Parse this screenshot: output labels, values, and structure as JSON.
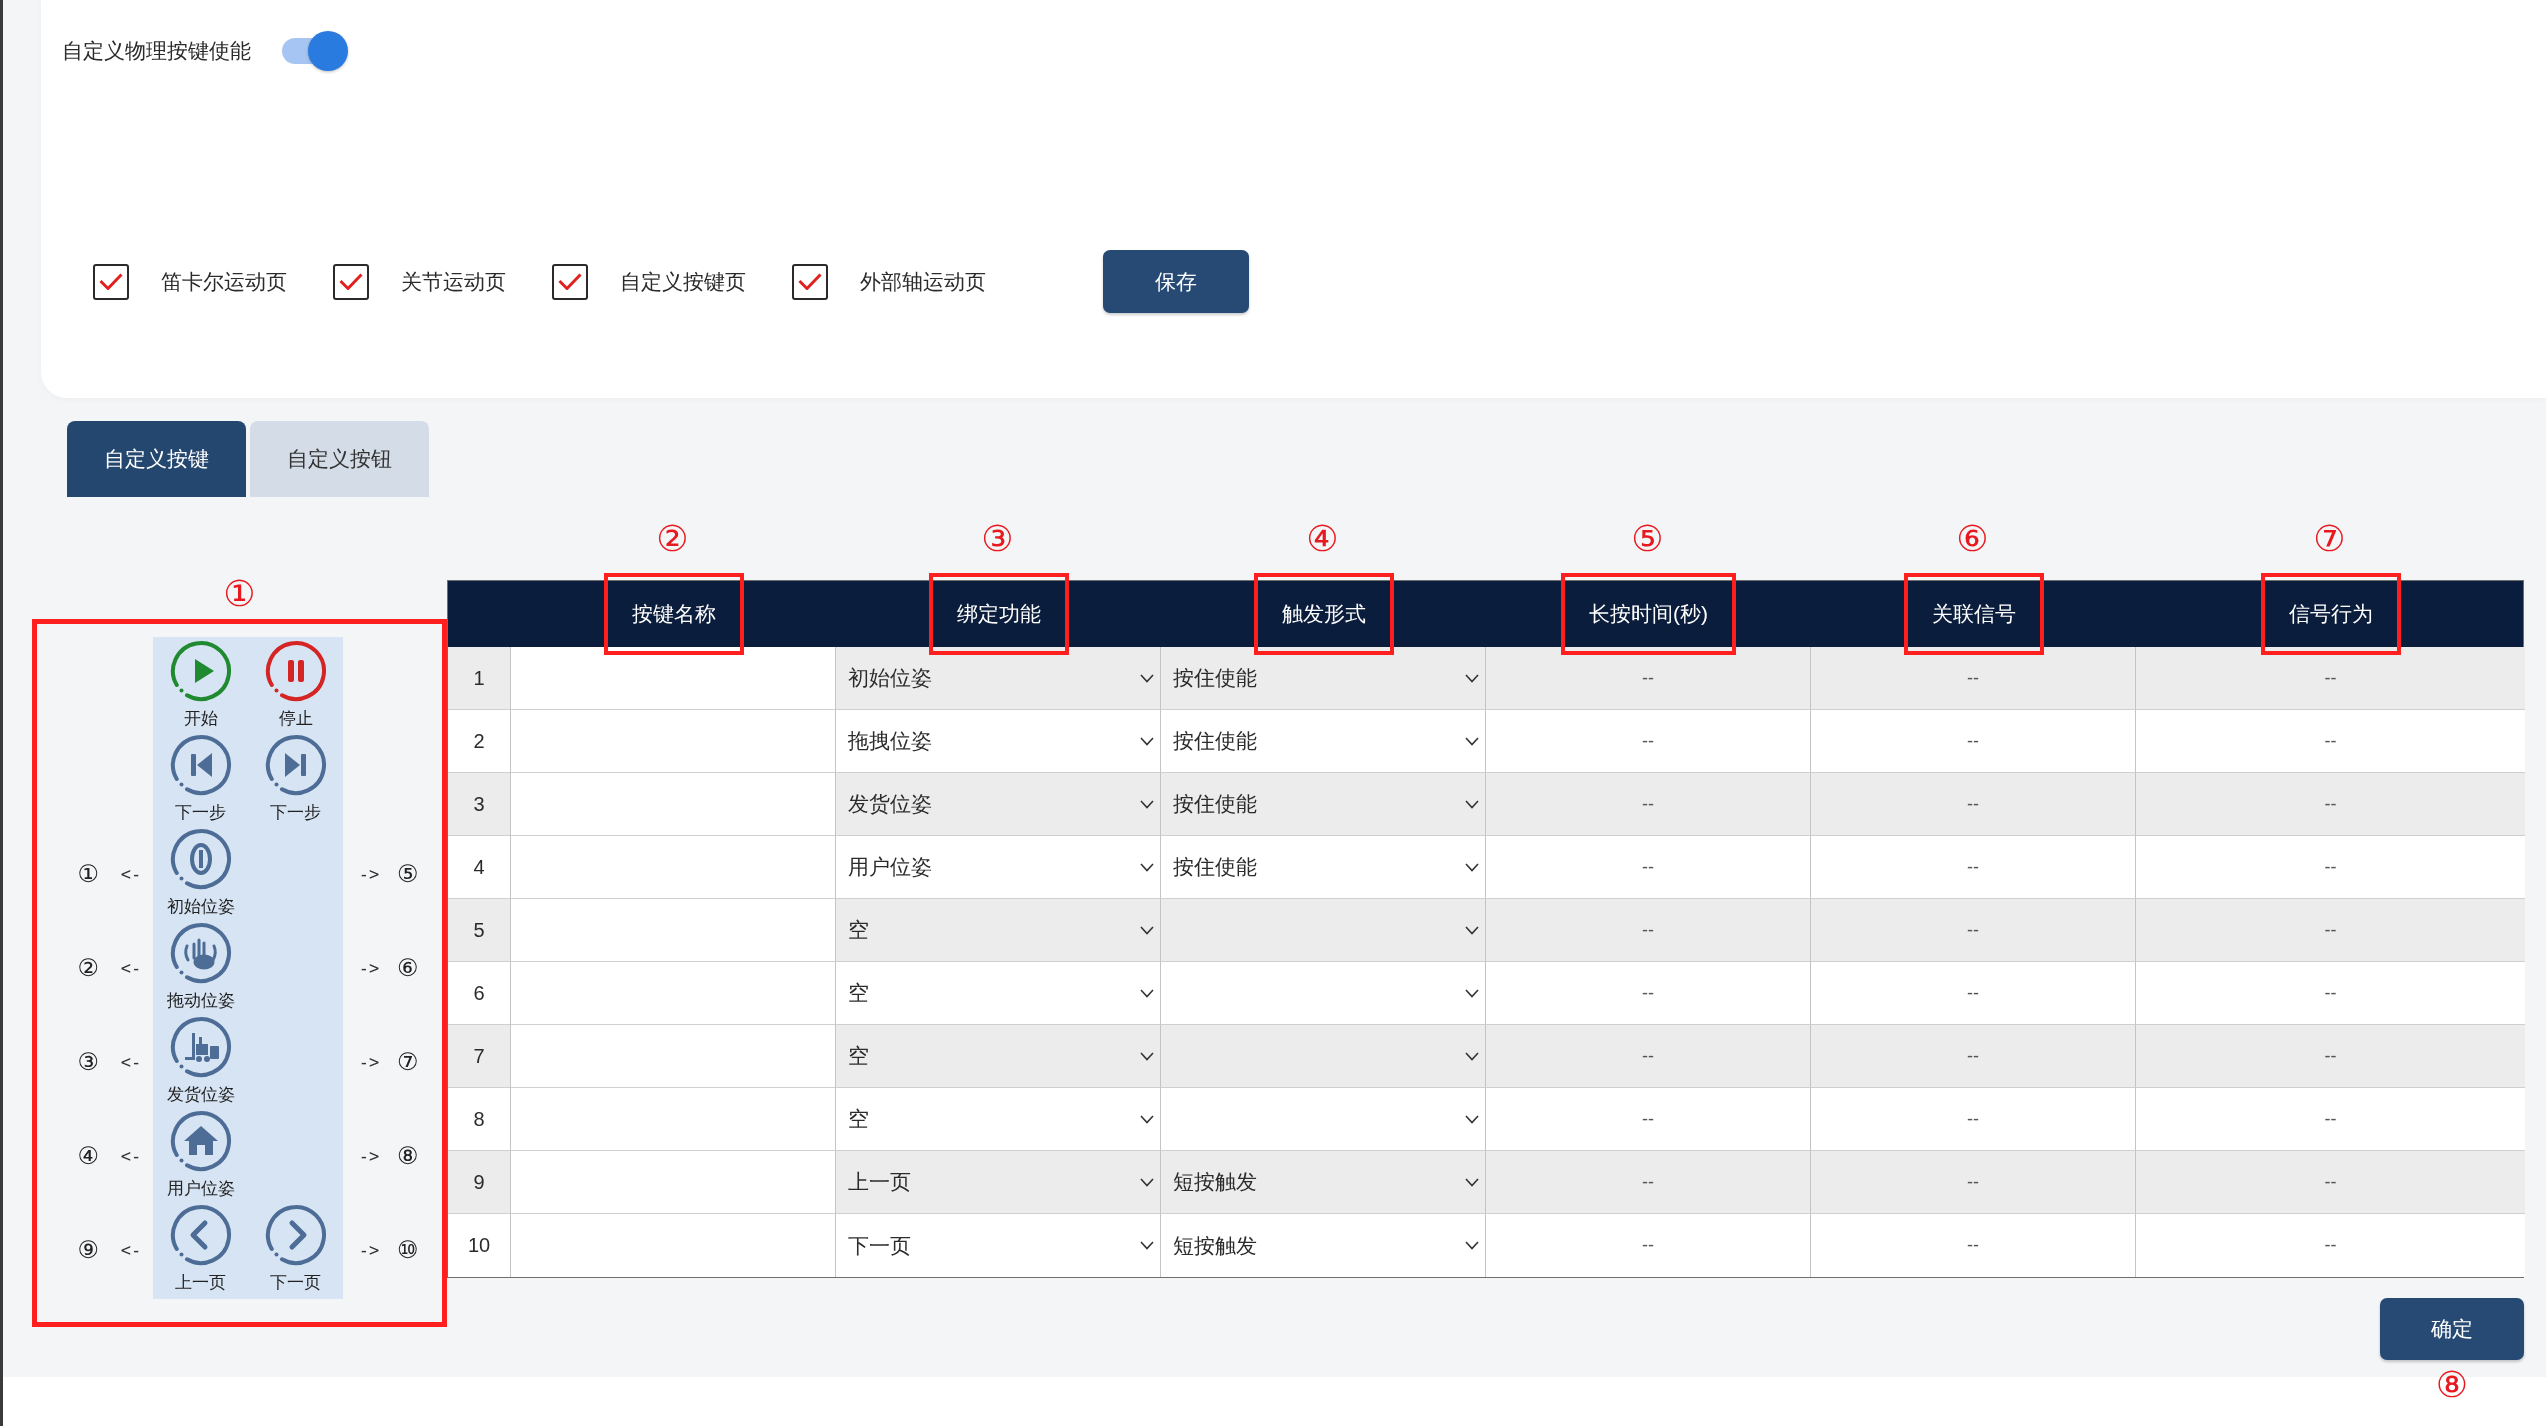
{
  "toggle": {
    "label": "自定义物理按键使能",
    "on": true
  },
  "page_options": [
    {
      "label": "笛卡尔运动页",
      "checked": true
    },
    {
      "label": "关节运动页",
      "checked": true
    },
    {
      "label": "自定义按键页",
      "checked": true
    },
    {
      "label": "外部轴运动页",
      "checked": true
    }
  ],
  "save_button": "保存",
  "tabs": [
    {
      "label": "自定义按键",
      "selected": true
    },
    {
      "label": "自定义按钮",
      "selected": false
    }
  ],
  "key_panel": {
    "marker": "①",
    "rows": [
      {
        "buttons": [
          {
            "kind": "play",
            "label": "开始"
          },
          {
            "kind": "pause",
            "label": "停止"
          }
        ]
      },
      {
        "buttons": [
          {
            "kind": "skip-back",
            "label": "下一步"
          },
          {
            "kind": "skip-forward",
            "label": "下一步"
          }
        ]
      },
      {
        "left_number": "①",
        "left_arrow": "<-",
        "buttons": [
          {
            "kind": "zero",
            "label": "初始位姿"
          }
        ],
        "right_arrow": "->",
        "right_number": "⑤"
      },
      {
        "left_number": "②",
        "left_arrow": "<-",
        "buttons": [
          {
            "kind": "hand",
            "label": "拖动位姿"
          }
        ],
        "right_arrow": "->",
        "right_number": "⑥"
      },
      {
        "left_number": "③",
        "left_arrow": "<-",
        "buttons": [
          {
            "kind": "forklift",
            "label": "发货位姿"
          }
        ],
        "right_arrow": "->",
        "right_number": "⑦"
      },
      {
        "left_number": "④",
        "left_arrow": "<-",
        "buttons": [
          {
            "kind": "house",
            "label": "用户位姿"
          }
        ],
        "right_arrow": "->",
        "right_number": "⑧"
      },
      {
        "left_number": "⑨",
        "left_arrow": "<-",
        "buttons": [
          {
            "kind": "page-back",
            "label": "上一页"
          },
          {
            "kind": "page-forward",
            "label": "下一页"
          }
        ],
        "right_arrow": "->",
        "right_number": "⑩"
      }
    ]
  },
  "table": {
    "columns": [
      {
        "label": "按键名称",
        "marker": "②"
      },
      {
        "label": "绑定功能",
        "marker": "③"
      },
      {
        "label": "触发形式",
        "marker": "④"
      },
      {
        "label": "长按时间(秒)",
        "marker": "⑤"
      },
      {
        "label": "关联信号",
        "marker": "⑥"
      },
      {
        "label": "信号行为",
        "marker": "⑦"
      }
    ],
    "rows": [
      {
        "number": "1",
        "function": "初始位姿",
        "trigger": "按住使能",
        "hold_time": "--",
        "signal": "--",
        "behavior": "--"
      },
      {
        "number": "2",
        "function": "拖拽位姿",
        "trigger": "按住使能",
        "hold_time": "--",
        "signal": "--",
        "behavior": "--"
      },
      {
        "number": "3",
        "function": "发货位姿",
        "trigger": "按住使能",
        "hold_time": "--",
        "signal": "--",
        "behavior": "--"
      },
      {
        "number": "4",
        "function": "用户位姿",
        "trigger": "按住使能",
        "hold_time": "--",
        "signal": "--",
        "behavior": "--"
      },
      {
        "number": "5",
        "function": "空",
        "hold_time": "--",
        "signal": "--",
        "behavior": "--"
      },
      {
        "number": "6",
        "function": "空",
        "hold_time": "--",
        "signal": "--",
        "behavior": "--"
      },
      {
        "number": "7",
        "function": "空",
        "hold_time": "--",
        "signal": "--",
        "behavior": "--"
      },
      {
        "number": "8",
        "function": "空",
        "hold_time": "--",
        "signal": "--",
        "behavior": "--"
      },
      {
        "number": "9",
        "function": "上一页",
        "trigger": "短按触发",
        "hold_time": "--",
        "signal": "--",
        "behavior": "--"
      },
      {
        "number": "10",
        "function": "下一页",
        "trigger": "短按触发",
        "hold_time": "--",
        "signal": "--",
        "behavior": "--"
      }
    ]
  },
  "confirm_button": {
    "label": "确定",
    "marker": "⑧"
  }
}
